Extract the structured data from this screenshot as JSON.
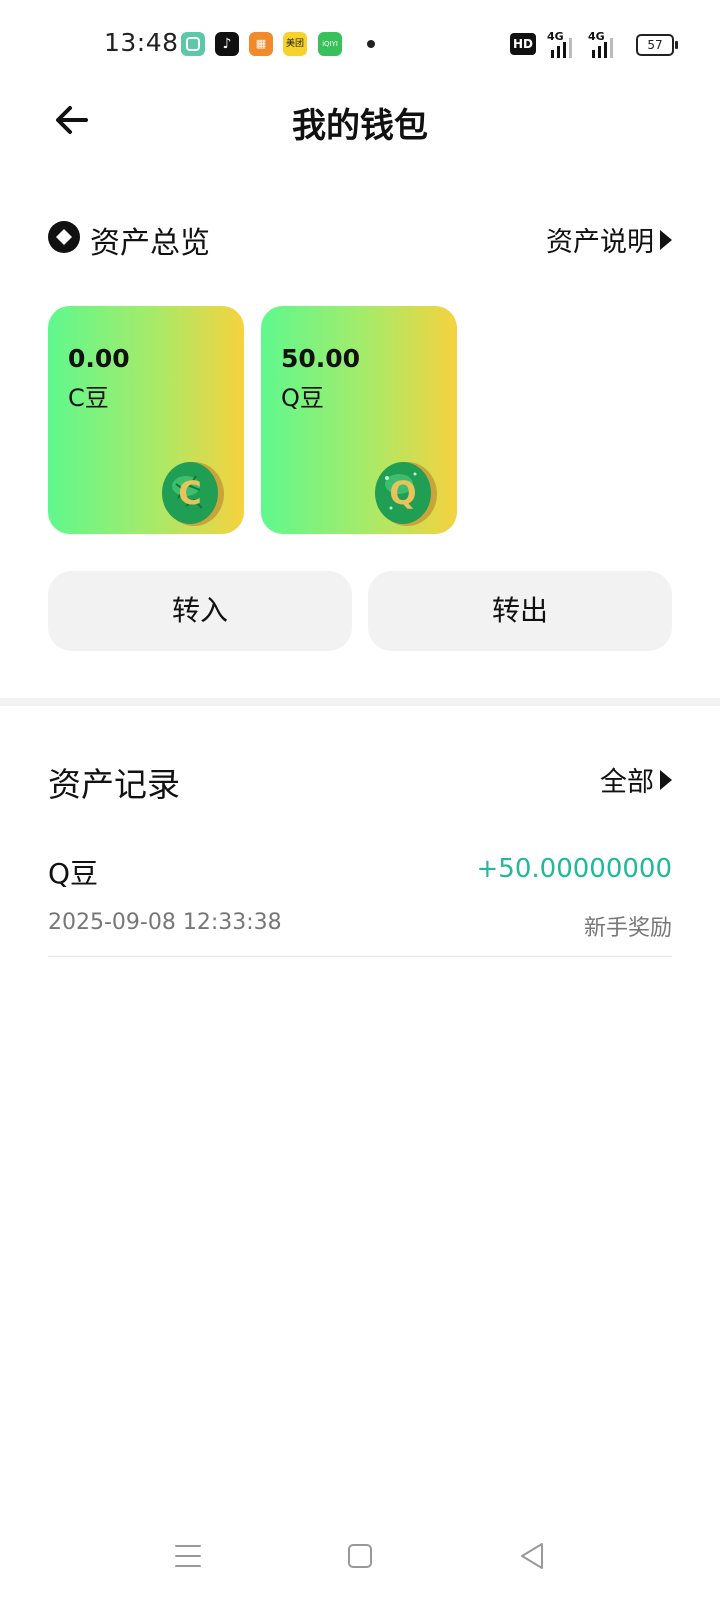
{
  "status_bar": {
    "time": "13:48",
    "apps": [
      {
        "name": "app-green",
        "color": "#5cc8a8"
      },
      {
        "name": "douyin",
        "color": "#111111"
      },
      {
        "name": "app-orange",
        "color": "#f08a2a"
      },
      {
        "name": "meituan",
        "color": "#f7d22a",
        "label": "美团"
      },
      {
        "name": "iqiyi",
        "color": "#38c15a",
        "label": "iQIYI"
      }
    ],
    "hd_label": "HD",
    "signal_label": "4G",
    "battery": "57"
  },
  "header": {
    "title": "我的钱包"
  },
  "overview": {
    "title": "资产总览",
    "explain_link": "资产说明",
    "cards": [
      {
        "amount": "0.00",
        "unit": "C豆",
        "coin_letter": "C"
      },
      {
        "amount": "50.00",
        "unit": "Q豆",
        "coin_letter": "Q"
      }
    ],
    "transfer_in": "转入",
    "transfer_out": "转出"
  },
  "records": {
    "title": "资产记录",
    "filter_link": "全部",
    "items": [
      {
        "name": "Q豆",
        "amount": "+50.00000000",
        "time": "2025-09-08 12:33:38",
        "note": "新手奖励"
      }
    ]
  },
  "colors": {
    "accent_green": "#22b89a",
    "card_gradient_start": "#5ff88e",
    "card_gradient_end": "#f6d23e"
  }
}
